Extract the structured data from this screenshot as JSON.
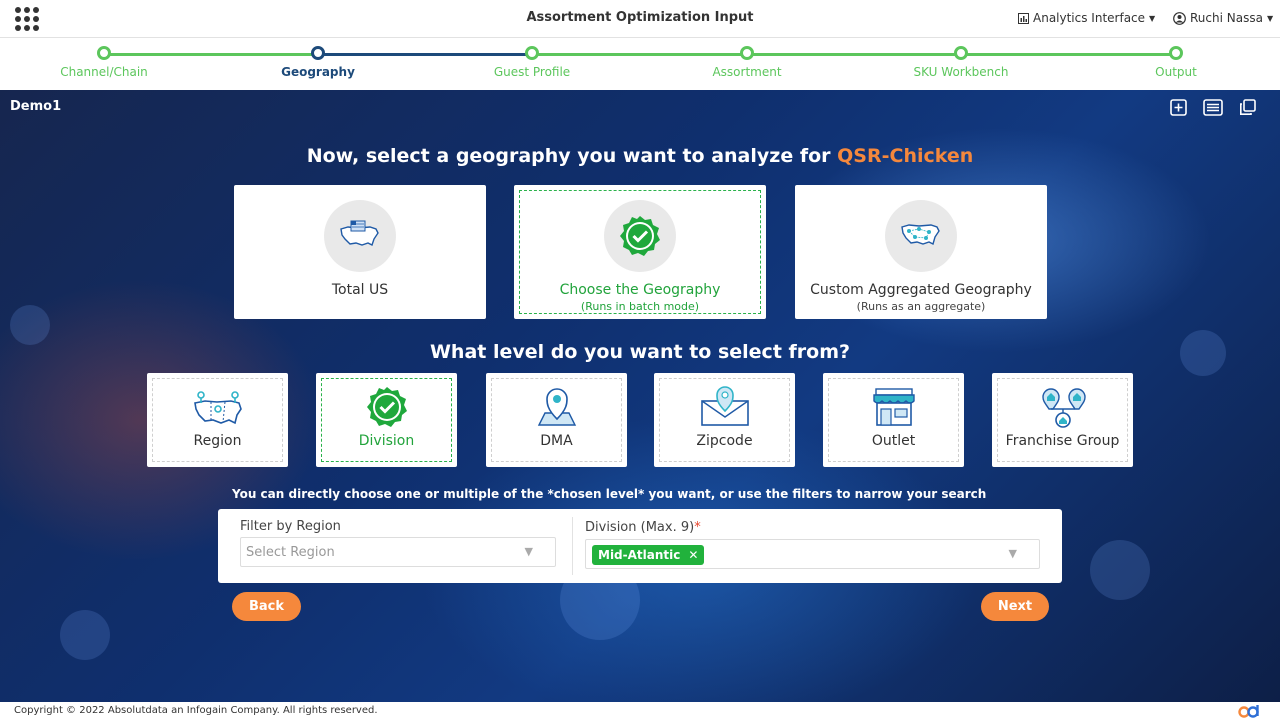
{
  "header": {
    "title": "Assortment Optimization Input",
    "analytics_menu": "Analytics Interface",
    "user_menu": "Ruchi Nassa"
  },
  "stepper": {
    "steps": [
      {
        "label": "Channel/Chain",
        "state": "done"
      },
      {
        "label": "Geography",
        "state": "active"
      },
      {
        "label": "Guest Profile",
        "state": "todo"
      },
      {
        "label": "Assortment",
        "state": "todo"
      },
      {
        "label": "SKU Workbench",
        "state": "todo"
      },
      {
        "label": "Output",
        "state": "todo"
      }
    ]
  },
  "project": {
    "name": "Demo1"
  },
  "geography": {
    "heading_prefix": "Now, select a geography you want to analyze for",
    "heading_highlight": "QSR-Chicken",
    "options": [
      {
        "title": "Total US",
        "sub": "",
        "icon": "us-map-flag-icon",
        "selected": false
      },
      {
        "title": "Choose the Geography",
        "sub": "(Runs in batch mode)",
        "icon": "checkmark-badge-icon",
        "selected": true
      },
      {
        "title": "Custom Aggregated Geography",
        "sub": "(Runs as an aggregate)",
        "icon": "us-map-network-icon",
        "selected": false
      }
    ]
  },
  "levels": {
    "heading": "What level do you want to select from?",
    "items": [
      {
        "label": "Region",
        "icon": "region-map-icon",
        "selected": false
      },
      {
        "label": "Division",
        "icon": "checkmark-badge-icon",
        "selected": true
      },
      {
        "label": "DMA",
        "icon": "dma-pin-icon",
        "selected": false
      },
      {
        "label": "Zipcode",
        "icon": "zipcode-envelope-icon",
        "selected": false
      },
      {
        "label": "Outlet",
        "icon": "storefront-icon",
        "selected": false
      },
      {
        "label": "Franchise Group",
        "icon": "franchise-houses-icon",
        "selected": false
      }
    ]
  },
  "hint": "You can directly choose one or multiple of the *chosen level* you want, or use the filters to narrow your search",
  "filters": {
    "region_label": "Filter by Region",
    "region_placeholder": "Select Region",
    "division_label": "Division (Max. 9)",
    "division_required": "*",
    "division_selected": "Mid-Atlantic"
  },
  "actions": {
    "back": "Back",
    "next": "Next"
  },
  "footer": {
    "copyright": "Copyright © 2022 Absolutdata an Infogain Company. All rights reserved."
  },
  "colors": {
    "accent": "#f5883c",
    "success": "#21a33b",
    "step_done": "#5cc65c",
    "step_active": "#1d4a7a"
  }
}
